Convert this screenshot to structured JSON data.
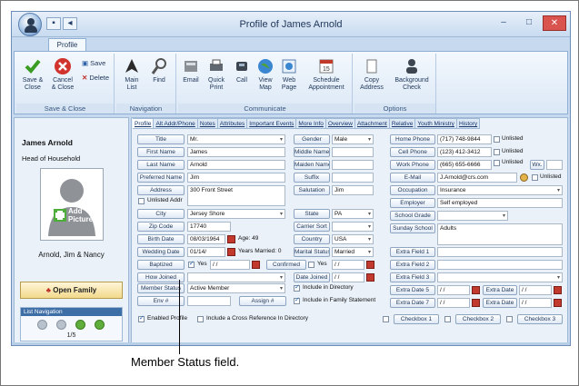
{
  "window": {
    "title": "Profile of James Arnold",
    "qat": [
      "save-icon",
      "back-icon"
    ],
    "controls": [
      "–",
      "□",
      "✕"
    ]
  },
  "ribbon": {
    "tab": "Profile",
    "groups": [
      {
        "label": "Save & Close",
        "buttons": [
          "Save &\nClose",
          "Cancel\n& Close"
        ],
        "small": [
          "Save",
          "Delete"
        ]
      },
      {
        "label": "Navigation",
        "buttons": [
          "Main\nList",
          "Find"
        ]
      },
      {
        "label": "Communicate",
        "buttons": [
          "Email",
          "Quick\nPrint",
          "Call",
          "View\nMap",
          "Web\nPage",
          "Schedule\nAppointment"
        ]
      },
      {
        "label": "Options",
        "buttons": [
          "Copy\nAddress",
          "Background\nCheck"
        ]
      }
    ]
  },
  "left": {
    "name": "James Arnold",
    "role": "Head of Household",
    "add_picture": "Add\nPicture",
    "household": "Arnold, Jim & Nancy",
    "open_family": "Open Family",
    "list_nav": "List Navigation",
    "count": "1/5"
  },
  "subtabs": [
    "Profile",
    "Alt Addr/Phone",
    "Notes",
    "Attributes",
    "Important Events",
    "More Info",
    "Overview",
    "Attachment",
    "Relative",
    "Youth Ministry",
    "History"
  ],
  "col1": {
    "title": {
      "label": "Title",
      "value": "Mr."
    },
    "first": {
      "label": "First Name",
      "value": "James"
    },
    "last": {
      "label": "Last Name",
      "value": "Arnold"
    },
    "preferred": {
      "label": "Preferred Name",
      "value": "Jim"
    },
    "address": {
      "label": "Address",
      "value": "300 Front Street"
    },
    "unlisted_addr": "Unlisted Addr",
    "city": {
      "label": "City",
      "value": "Jersey Shore"
    },
    "zip": {
      "label": "Zip Code",
      "value": "17740"
    },
    "birth": {
      "label": "Birth Date",
      "value": "08/03/1964",
      "age": "Age: 49"
    },
    "wedding": {
      "label": "Wedding Date",
      "value": "01/14/",
      "years": "Years Married: 0"
    },
    "baptized": {
      "label": "Baptized",
      "yes": "Yes",
      "date": "/ /"
    },
    "how_joined": {
      "label": "How Joined",
      "value": ""
    },
    "member_status": {
      "label": "Member Status",
      "value": "Active Member"
    },
    "env": {
      "label": "Env #",
      "value": ""
    },
    "enabled_profile": "Enabled Profile"
  },
  "col2": {
    "gender": {
      "label": "Gender",
      "value": "Male"
    },
    "middle": {
      "label": "Middle Name",
      "value": ""
    },
    "maiden": {
      "label": "Maiden Name",
      "value": ""
    },
    "suffix": {
      "label": "Suffix",
      "value": ""
    },
    "salutation": {
      "label": "Salutation",
      "value": "Jim"
    },
    "state": {
      "label": "State",
      "value": "PA"
    },
    "carrier": {
      "label": "Carrier Sort",
      "value": ""
    },
    "country": {
      "label": "Country",
      "value": "USA"
    },
    "marital": {
      "label": "Marital Status",
      "value": "Married"
    },
    "confirmed": {
      "label": "Confirmed",
      "yes": "Yes",
      "date": "/ /"
    },
    "date_joined": {
      "label": "Date Joined",
      "value": "/ /"
    },
    "assign": "Assign #",
    "include_dir": "Include in Directory",
    "include_stmt": "Include in Family Statement",
    "cross_ref": "Include a Cross Reference In Directory"
  },
  "col3": {
    "home": {
      "label": "Home Phone",
      "value": "(717) 748-9844",
      "unlisted": "Unlisted"
    },
    "cell": {
      "label": "Cell Phone",
      "value": "(123) 412-3412",
      "unlisted": "Unlisted"
    },
    "work": {
      "label": "Work Phone",
      "value": "(665) 655-6666",
      "unlisted": "Unlisted",
      "wx": "Wx."
    },
    "email": {
      "label": "E-Mail",
      "value": "J.Arnold@crs.com",
      "unlisted": "Unlisted"
    },
    "occupation": {
      "label": "Occupation",
      "value": "Insurance"
    },
    "employer": {
      "label": "Employer",
      "value": "Self employed"
    },
    "school_grade": {
      "label": "School Grade",
      "value": ""
    },
    "sunday_school": {
      "label": "Sunday School",
      "value": "Adults"
    },
    "extra1": "Extra Field 1",
    "extra2": "Extra Field 2",
    "extra3": "Extra Field 3",
    "extra_date5": {
      "label": "Extra Date 5",
      "value": "/ /"
    },
    "extra_date6": {
      "label": "Extra Date",
      "value": "/ /"
    },
    "extra_date7": {
      "label": "Extra Date 7",
      "value": "/ /"
    },
    "extra_date8": {
      "label": "Extra Date",
      "value": "/ /"
    },
    "checkbox1": "Checkbox 1",
    "checkbox2": "Checkbox 2",
    "checkbox3": "Checkbox 3"
  },
  "callout": "Member Status field."
}
